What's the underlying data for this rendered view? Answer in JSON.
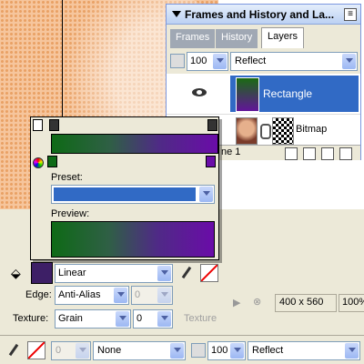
{
  "panel": {
    "title": "Frames and History and La...",
    "tabs": [
      "Frames",
      "History",
      "Layers"
    ],
    "opacity": "100",
    "blend_mode": "Reflect",
    "layers": [
      {
        "name": "Rectangle",
        "selected": true
      },
      {
        "name": "Bitmap",
        "selected": false
      }
    ],
    "frame_label": "ne 1"
  },
  "gradient_editor": {
    "preset_label": "Preset:",
    "preview_label": "Preview:",
    "colors": [
      "#0e6a16",
      "#6a0ca8"
    ]
  },
  "properties": {
    "fill_type": "Linear",
    "edge_label": "Edge:",
    "edge_value": "Anti-Alias",
    "edge_amount": "0",
    "texture_label": "Texture:",
    "texture_value": "Grain",
    "texture_amount": "0",
    "texture_right": "Texture"
  },
  "status": {
    "size": "400 x 560",
    "zoom": "100%"
  },
  "bottom_bar": {
    "stroke_value": "0",
    "stroke_type": "None",
    "opacity": "100",
    "blend_mode": "Reflect"
  }
}
